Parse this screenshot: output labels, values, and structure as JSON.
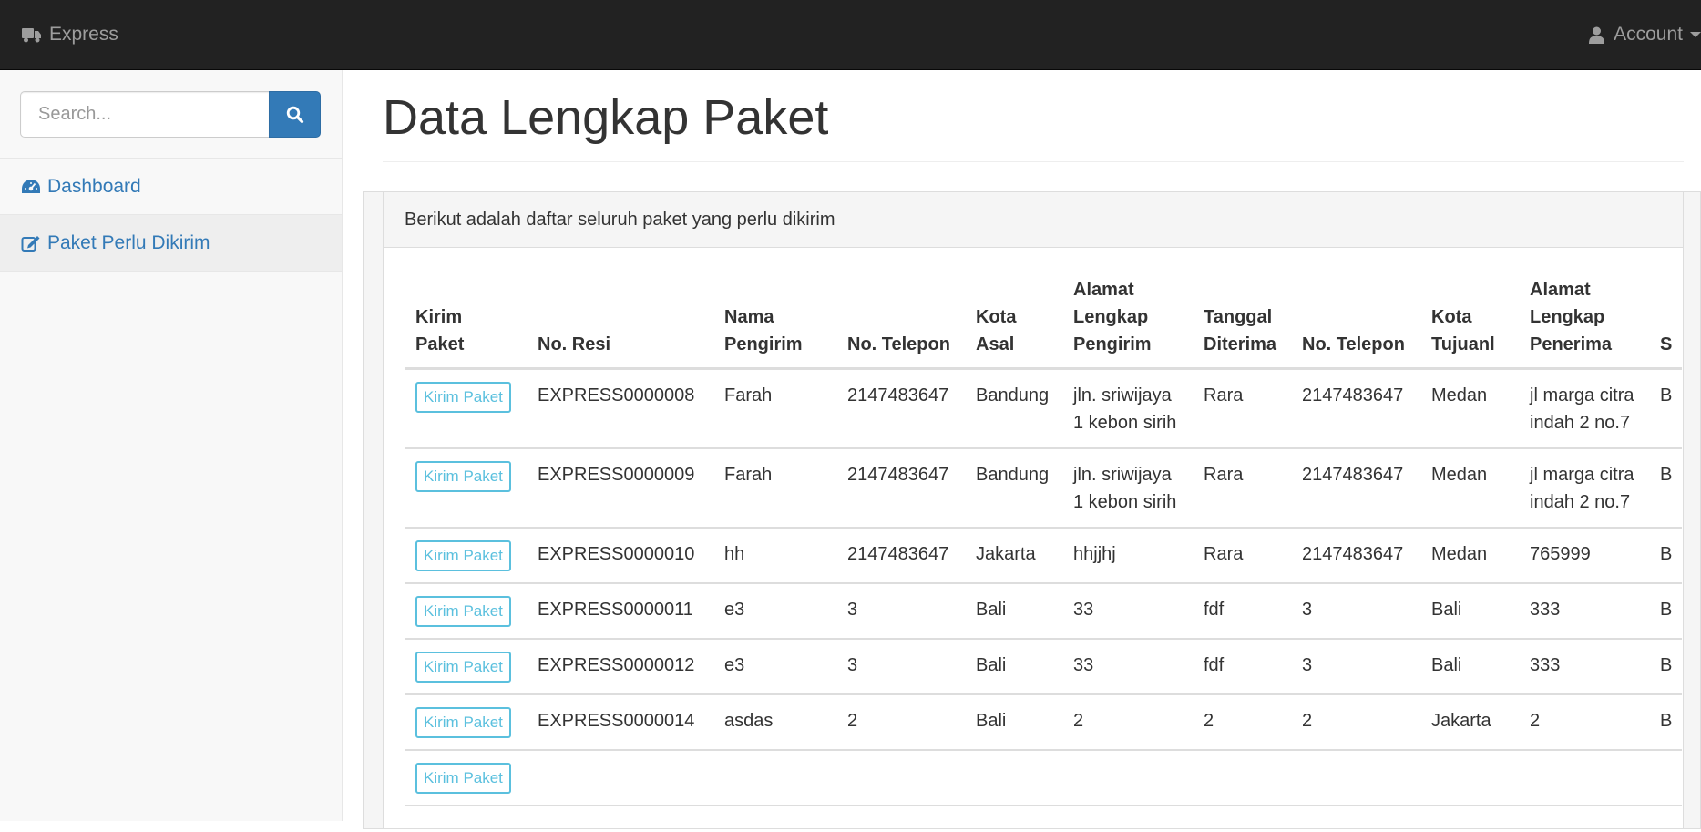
{
  "navbar": {
    "brand": "Express",
    "account": "Account"
  },
  "sidebar": {
    "search_placeholder": "Search...",
    "items": [
      {
        "label": "Dashboard"
      },
      {
        "label": "Paket Perlu Dikirim"
      }
    ]
  },
  "main": {
    "title": "Data Lengkap Paket",
    "panel_heading": "Berikut adalah daftar seluruh paket yang perlu dikirim"
  },
  "table": {
    "headers": [
      "Kirim Paket",
      "No. Resi",
      "Nama Pengirim",
      "No. Telepon",
      "Kota Asal",
      "Alamat Lengkap Pengirim",
      "Tanggal Diterima",
      "No. Telepon",
      "Kota Tujuanl",
      "Alamat Lengkap Penerima",
      "S"
    ],
    "action_label": "Kirim Paket",
    "rows": [
      {
        "resi": "EXPRESS0000008",
        "nama": "Farah",
        "telp": "2147483647",
        "asal": "Bandung",
        "alamat_pengirim": "jln. sriwijaya 1 kebon sirih",
        "tanggal": "Rara",
        "telp2": "2147483647",
        "tujuan": "Medan",
        "alamat_penerima": "jl marga citra indah 2 no.7",
        "extra": "B"
      },
      {
        "resi": "EXPRESS0000009",
        "nama": "Farah",
        "telp": "2147483647",
        "asal": "Bandung",
        "alamat_pengirim": "jln. sriwijaya 1 kebon sirih",
        "tanggal": "Rara",
        "telp2": "2147483647",
        "tujuan": "Medan",
        "alamat_penerima": "jl marga citra indah 2 no.7",
        "extra": "B"
      },
      {
        "resi": "EXPRESS0000010",
        "nama": "hh",
        "telp": "2147483647",
        "asal": "Jakarta",
        "alamat_pengirim": "hhjjhj",
        "tanggal": "Rara",
        "telp2": "2147483647",
        "tujuan": "Medan",
        "alamat_penerima": "765999",
        "extra": "B"
      },
      {
        "resi": "EXPRESS0000011",
        "nama": "e3",
        "telp": "3",
        "asal": "Bali",
        "alamat_pengirim": "33",
        "tanggal": "fdf",
        "telp2": "3",
        "tujuan": "Bali",
        "alamat_penerima": "333",
        "extra": "B"
      },
      {
        "resi": "EXPRESS0000012",
        "nama": "e3",
        "telp": "3",
        "asal": "Bali",
        "alamat_pengirim": "33",
        "tanggal": "fdf",
        "telp2": "3",
        "tujuan": "Bali",
        "alamat_penerima": "333",
        "extra": "B"
      },
      {
        "resi": "EXPRESS0000014",
        "nama": "asdas",
        "telp": "2",
        "asal": "Bali",
        "alamat_pengirim": "2",
        "tanggal": "2",
        "telp2": "2",
        "tujuan": "Jakarta",
        "alamat_penerima": "2",
        "extra": "B"
      }
    ],
    "partial_last_row": true
  },
  "icons": {
    "brand": "truck-icon",
    "account": "user-icon",
    "search": "search-icon",
    "dashboard": "dashboard-icon",
    "paket": "edit-icon"
  },
  "colors": {
    "navbar_bg": "#222222",
    "link": "#337ab7",
    "info_button": "#5bc0de",
    "sidebar_bg": "#f8f8f8"
  }
}
